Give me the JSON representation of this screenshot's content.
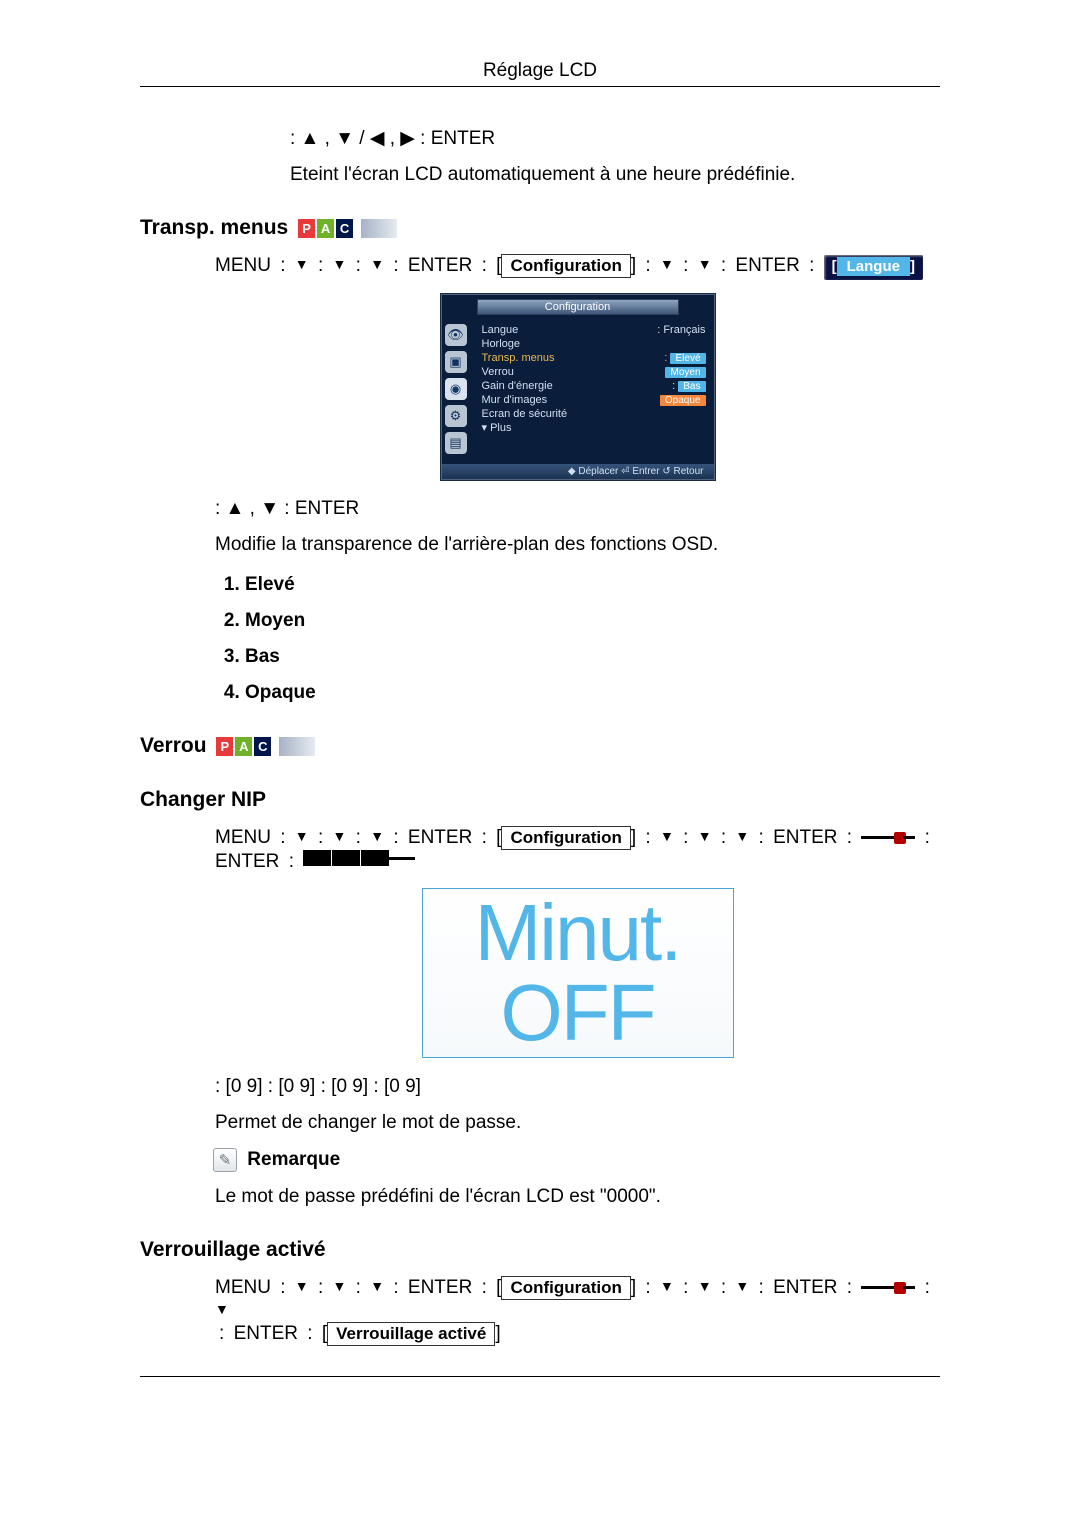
{
  "page_title": "Réglage LCD",
  "nav_line1": ":  ▲ , ▼ /  ◀ , ▶  : ENTER",
  "line_auto_off": "Eteint l'écran LCD automatiquement à une heure prédéfinie.",
  "heading_transp": "Transp. menus",
  "pac": {
    "p": "P",
    "a": "A",
    "c": "C"
  },
  "transp_path": {
    "menu": "MENU",
    "colon": ":",
    "down": "▼",
    "enter": "ENTER",
    "config_label": "Configuration",
    "langue_label": "Langue"
  },
  "osd": {
    "title": "Configuration",
    "rows": [
      {
        "k": "Langue",
        "v": "Français",
        "vtype": "plain",
        "colon": ":"
      },
      {
        "k": "Horloge",
        "v": "",
        "vtype": "none"
      },
      {
        "k": "Transp. menus",
        "v": "Elevé",
        "vtype": "block",
        "hl": true,
        "colon": ":"
      },
      {
        "k": "Verrou",
        "v": "Moyen",
        "vtype": "block"
      },
      {
        "k": "Gain d'énergie",
        "v": "Bas",
        "vtype": "block",
        "colon": ":"
      },
      {
        "k": "Mur d'images",
        "v": "Opaque",
        "vtype": "orange"
      },
      {
        "k": "Ecran de sécurité",
        "v": "",
        "vtype": "none"
      },
      {
        "k": "▾  Plus",
        "v": "",
        "vtype": "none"
      }
    ],
    "foot": "◆ Déplacer   ⏎ Entrer   ↺ Retour"
  },
  "nav_line2": ":  ▲ , ▼  : ENTER",
  "line_transp_desc": "Modifie la transparence de l'arrière-plan des fonctions OSD.",
  "options": [
    "Elevé",
    "Moyen",
    "Bas",
    "Opaque"
  ],
  "heading_verrou": "Verrou",
  "heading_changer_nip": "Changer NIP",
  "changer_path": {
    "enter2": "ENTER"
  },
  "lcd_text": "Minut. OFF",
  "digits_line": ": [0  9]  : [0  9]  : [0  9]  : [0  9]",
  "line_change_pw": "Permet de changer le mot de passe.",
  "heading_remarque": "Remarque",
  "line_default_pw": "Le mot de passe prédéfini de l'écran LCD est \"0000\".",
  "heading_verrou_active": "Verrouillage activé",
  "verrou_active_label": "Verrouillage activé"
}
